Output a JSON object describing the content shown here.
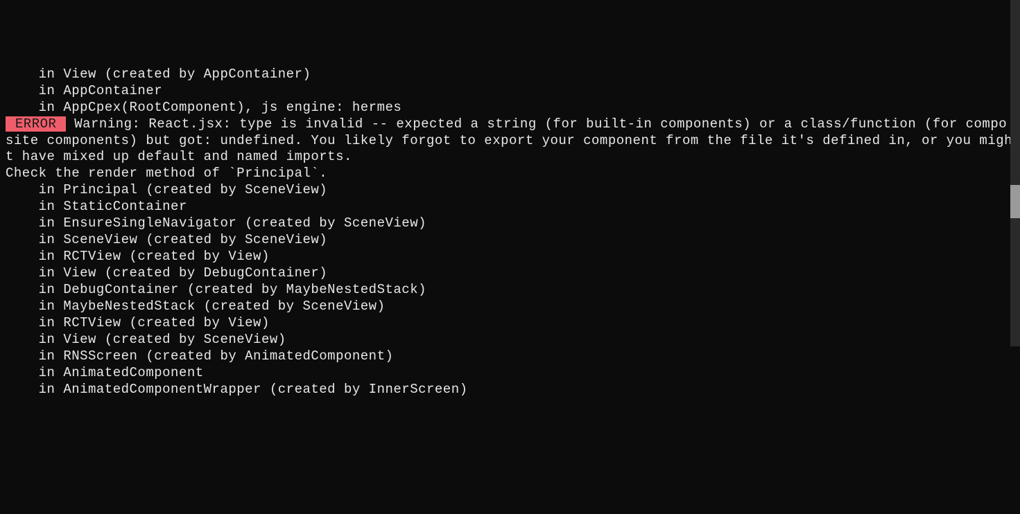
{
  "terminal": {
    "pre_lines": [
      "    in View (created by AppContainer)",
      "    in AppContainer",
      "    in AppCpex(RootComponent), js engine: hermes"
    ],
    "error_label": " ERROR ",
    "error_message": " Warning: React.jsx: type is invalid -- expected a string (for built-in components) or a class/function (for composite components) but got: undefined. You likely forgot to export your component from the file it's defined in, or you might have mixed up default and named imports.",
    "blank": "",
    "check_line": "Check the render method of `Principal`.",
    "stack_lines": [
      "    in Principal (created by SceneView)",
      "    in StaticContainer",
      "    in EnsureSingleNavigator (created by SceneView)",
      "    in SceneView (created by SceneView)",
      "    in RCTView (created by View)",
      "    in View (created by DebugContainer)",
      "    in DebugContainer (created by MaybeNestedStack)",
      "    in MaybeNestedStack (created by SceneView)",
      "    in RCTView (created by View)",
      "    in View (created by SceneView)",
      "    in RNSScreen (created by AnimatedComponent)",
      "    in AnimatedComponent",
      "    in AnimatedComponentWrapper (created by InnerScreen)"
    ]
  }
}
